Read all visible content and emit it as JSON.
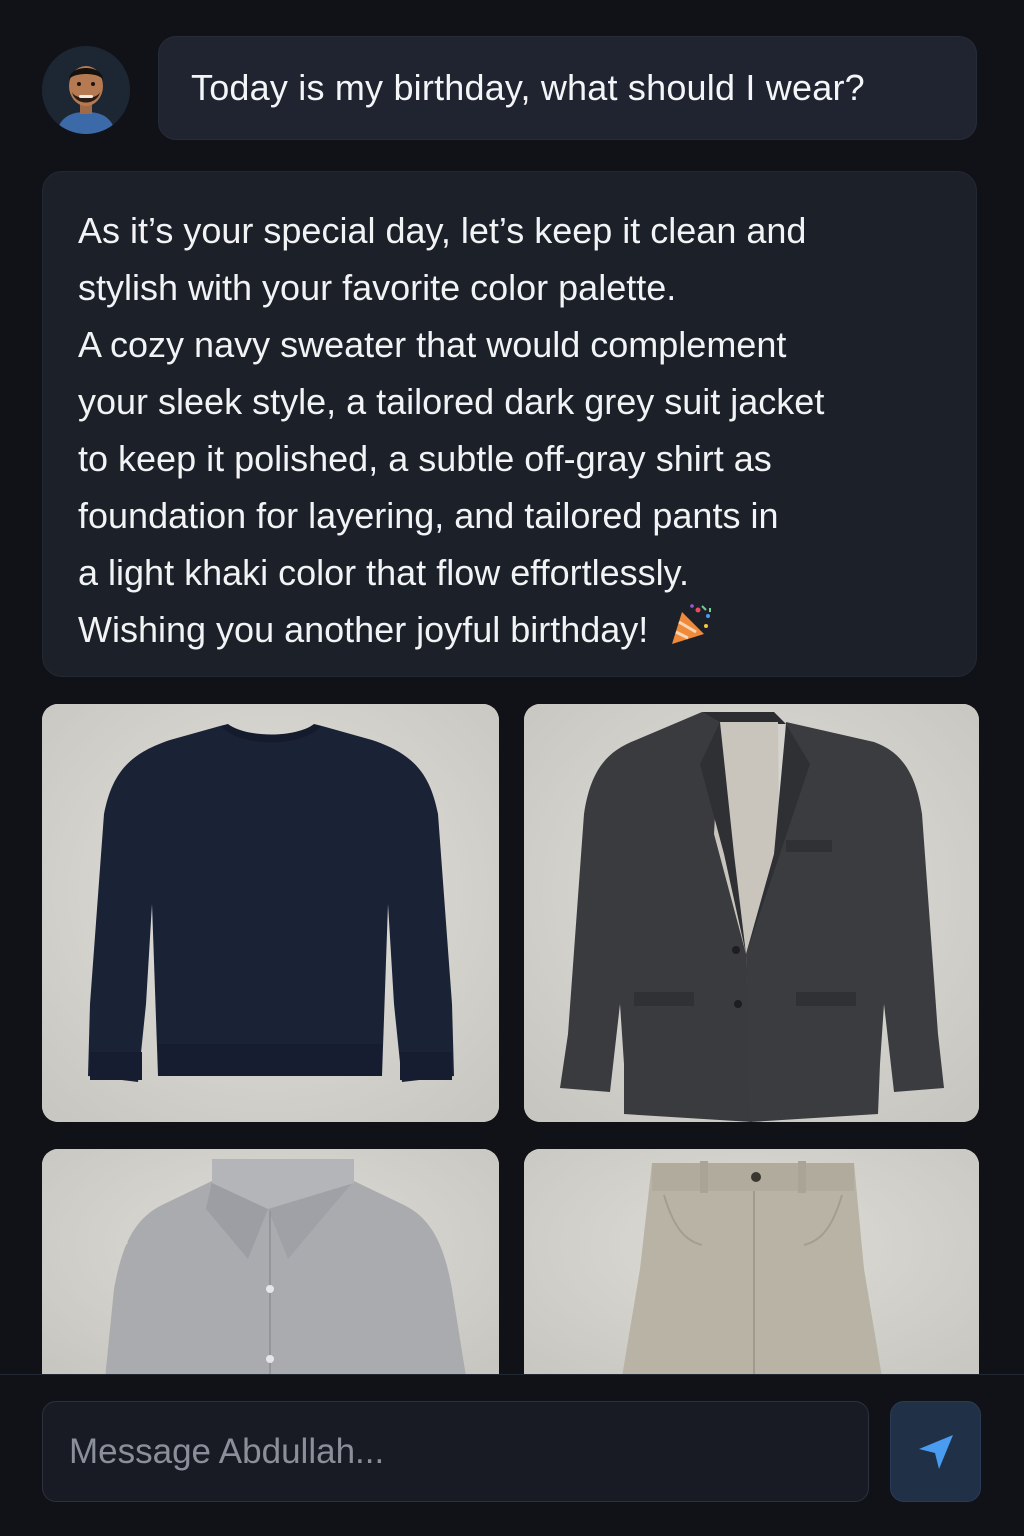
{
  "user_message": {
    "text": "Today is my birthday, what should I wear?"
  },
  "assistant_message": {
    "lines": [
      "As it’s your special day, let’s keep it clean and",
      "stylish with your favorite color palette.",
      "A cozy navy sweater that would complement",
      "your sleek style, a tailored dark grey suit jacket",
      "to keep it polished, a subtle off-gray shirt as",
      "foundation for layering, and tailored pants in",
      "a light khaki color that flow effortlessly.",
      "Wishing you another joyful birthday!"
    ],
    "emoji_icon": "party-popper-icon"
  },
  "outfit_images": [
    {
      "item": "navy sweater",
      "color": "#1a2236"
    },
    {
      "item": "dark grey suit jacket",
      "color": "#3a3c40"
    },
    {
      "item": "off-gray shirt",
      "color": "#a9abaf"
    },
    {
      "item": "light khaki pants",
      "color": "#b9b3a6"
    }
  ],
  "composer": {
    "placeholder": "Message Abdullah...",
    "send_icon": "send-icon"
  },
  "colors": {
    "background": "#111217",
    "bubble": "#1c2029",
    "send_button": "#1f3047",
    "accent": "#4a9cf0"
  }
}
